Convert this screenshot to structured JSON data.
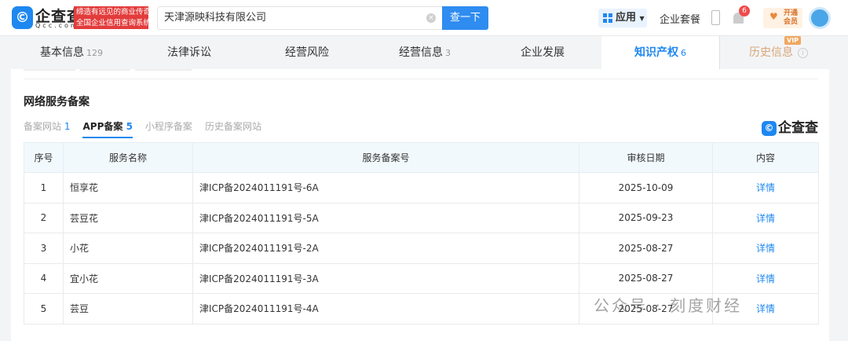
{
  "header": {
    "logo": "企查查",
    "logo_sub": "Qcc.com",
    "slogan_line1": "缔造有远见的商业传奇",
    "slogan_line2": "全国企业信用查询系统",
    "search_value": "天津源映科技有限公司",
    "search_button": "查一下",
    "apps_label": "应用",
    "package_label": "企业套餐",
    "notification_count": "6",
    "vip_line1": "开通",
    "vip_line2": "会员"
  },
  "tabs": [
    {
      "label": "基本信息",
      "count": "129"
    },
    {
      "label": "法律诉讼",
      "count": ""
    },
    {
      "label": "经营风险",
      "count": ""
    },
    {
      "label": "经营信息",
      "count": "3"
    },
    {
      "label": "企业发展",
      "count": ""
    },
    {
      "label": "知识产权",
      "count": "6"
    },
    {
      "label": "历史信息",
      "count": "",
      "tag": "VIP"
    }
  ],
  "section": {
    "title": "网络服务备案",
    "brand": "企查查",
    "subtabs": [
      {
        "label": "备案网站",
        "count": "1"
      },
      {
        "label": "APP备案",
        "count": "5"
      },
      {
        "label": "小程序备案",
        "count": ""
      },
      {
        "label": "历史备案网站",
        "count": ""
      }
    ]
  },
  "table": {
    "headers": [
      "序号",
      "服务名称",
      "服务备案号",
      "审核日期",
      "内容"
    ],
    "rows": [
      [
        "1",
        "恒享花",
        "津ICP备2024011191号-6A",
        "2025-10-09",
        "详情"
      ],
      [
        "2",
        "芸豆花",
        "津ICP备2024011191号-5A",
        "2025-09-23",
        "详情"
      ],
      [
        "3",
        "小花",
        "津ICP备2024011191号-2A",
        "2025-08-27",
        "详情"
      ],
      [
        "4",
        "宜小花",
        "津ICP备2024011191号-3A",
        "2025-08-27",
        "详情"
      ],
      [
        "5",
        "芸豆",
        "津ICP备2024011191号-4A",
        "2025-08-27",
        "详情"
      ]
    ]
  },
  "watermark": "公众号 · 刻度财经"
}
